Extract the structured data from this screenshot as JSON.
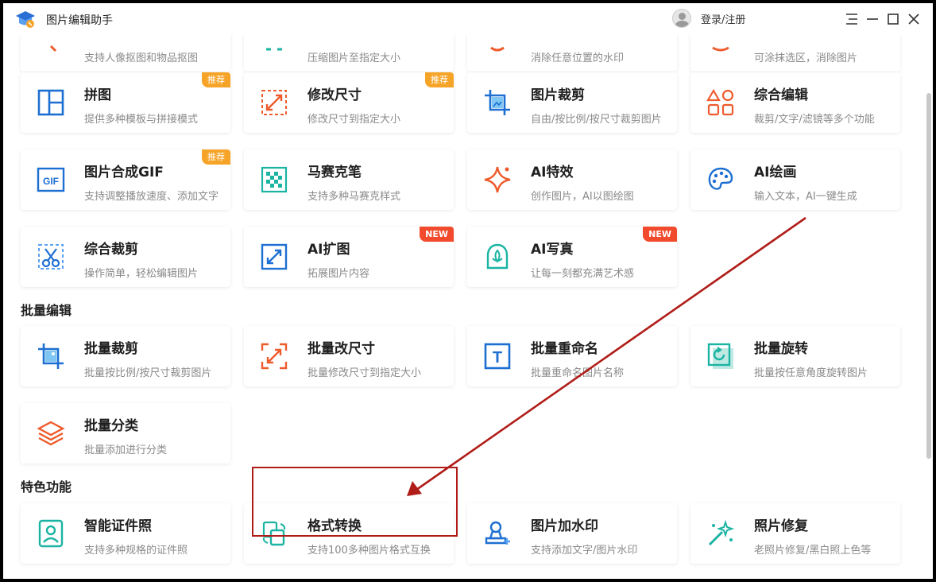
{
  "app": {
    "title": "图片编辑助手",
    "login": "登录/注册"
  },
  "colors": {
    "blue": "#1d6fd1",
    "orange": "#ee5b2d",
    "teal": "#1bb4a3",
    "badge_recommend": "#f6a427",
    "badge_new": "#f24a2c",
    "annotation": "#b01d18"
  },
  "top_partial": [
    {
      "desc": "支持人像抠图和物品抠图"
    },
    {
      "desc": "压缩图片至指定大小"
    },
    {
      "desc": "消除任意位置的水印"
    },
    {
      "desc": "可涂抹选区，消除图片"
    }
  ],
  "tools": [
    {
      "title": "拼图",
      "desc": "提供多种模板与拼接模式",
      "icon": "collage-icon",
      "badge": "推荐"
    },
    {
      "title": "修改尺寸",
      "desc": "修改尺寸到指定大小",
      "icon": "resize-icon",
      "badge": "推荐"
    },
    {
      "title": "图片裁剪",
      "desc": "自由/按比例/按尺寸裁剪图片",
      "icon": "crop-icon",
      "badge": ""
    },
    {
      "title": "综合编辑",
      "desc": "裁剪/文字/滤镜等多个功能",
      "icon": "shapes-icon",
      "badge": ""
    },
    {
      "title": "图片合成GIF",
      "desc": "支持调整播放速度、添加文字",
      "icon": "gif-icon",
      "badge": "推荐",
      "icon_text": "GIF"
    },
    {
      "title": "马赛克笔",
      "desc": "支持多种马赛克样式",
      "icon": "mosaic-icon",
      "badge": ""
    },
    {
      "title": "AI特效",
      "desc": "创作图片，AI以图绘图",
      "icon": "sparkle-icon",
      "badge": ""
    },
    {
      "title": "AI绘画",
      "desc": "输入文本，AI一键生成",
      "icon": "palette-icon",
      "badge": ""
    },
    {
      "title": "综合裁剪",
      "desc": "操作简单，轻松编辑图片",
      "icon": "scissors-icon",
      "badge": ""
    },
    {
      "title": "AI扩图",
      "desc": "拓展图片内容",
      "icon": "expand-icon",
      "badge": "NEW"
    },
    {
      "title": "AI写真",
      "desc": "让每一刻都充满艺术感",
      "icon": "portrait-art-icon",
      "badge": "NEW"
    }
  ],
  "batch": {
    "title": "批量编辑",
    "items": [
      {
        "title": "批量裁剪",
        "desc": "批量按比例/按尺寸裁剪图片",
        "icon": "batch-crop-icon"
      },
      {
        "title": "批量改尺寸",
        "desc": "批量修改尺寸到指定大小",
        "icon": "batch-resize-icon"
      },
      {
        "title": "批量重命名",
        "desc": "批量重命名图片名称",
        "icon": "rename-icon",
        "icon_text": "T"
      },
      {
        "title": "批量旋转",
        "desc": "批量按任意角度旋转图片",
        "icon": "rotate-icon"
      },
      {
        "title": "批量分类",
        "desc": "批量添加进行分类",
        "icon": "layers-icon"
      }
    ]
  },
  "features": {
    "title": "特色功能",
    "items": [
      {
        "title": "智能证件照",
        "desc": "支持多种规格的证件照",
        "icon": "id-photo-icon"
      },
      {
        "title": "格式转换",
        "desc": "支持100多种图片格式互换",
        "icon": "convert-icon"
      },
      {
        "title": "图片加水印",
        "desc": "支持添加文字/图片水印",
        "icon": "watermark-icon"
      },
      {
        "title": "照片修复",
        "desc": "老照片修复/黑白照上色等",
        "icon": "magic-wand-icon"
      }
    ]
  }
}
